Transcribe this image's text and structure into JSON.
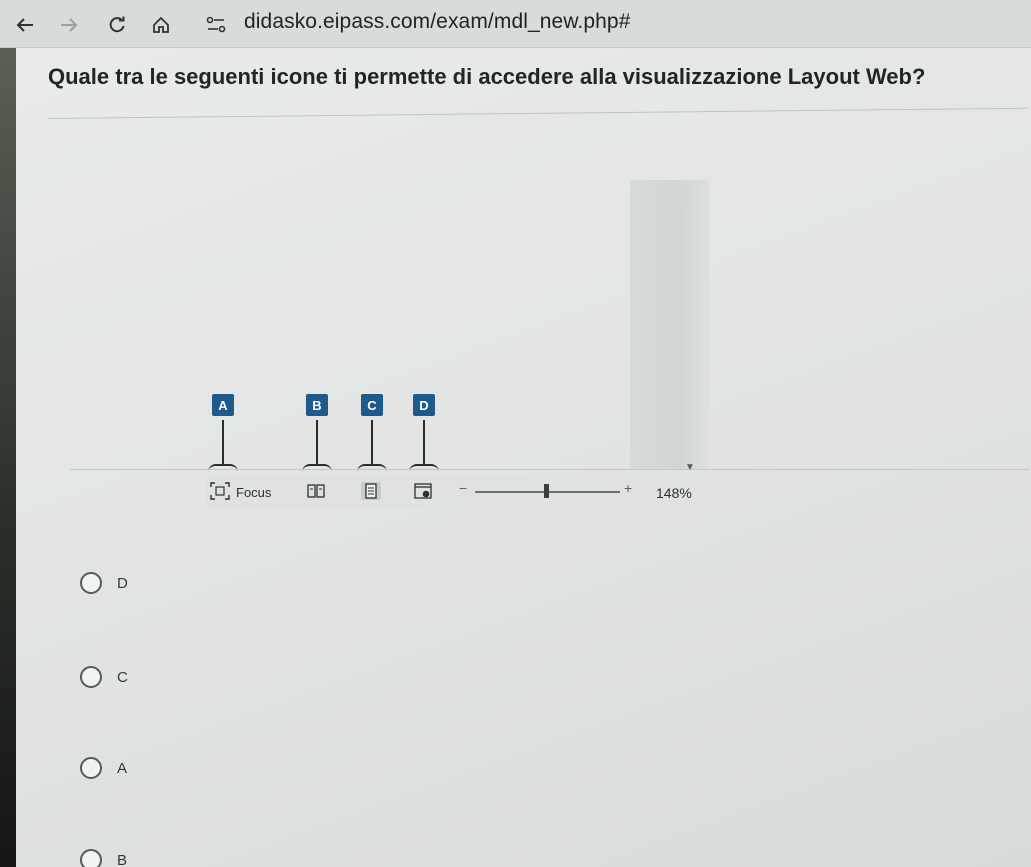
{
  "browser": {
    "url": "didasko.eipass.com/exam/mdl_new.php#",
    "icons": [
      "back-arrow-icon",
      "forward-arrow-icon",
      "reload-icon",
      "home-icon",
      "site-info-icon"
    ]
  },
  "question": {
    "text": "Quale tra le seguenti icone ti permette di accedere alla visualizzazione Layout Web?"
  },
  "figure": {
    "callouts": [
      {
        "letter": "A"
      },
      {
        "letter": "B"
      },
      {
        "letter": "C"
      },
      {
        "letter": "D"
      }
    ],
    "statusbar": {
      "focus_label": "Focus",
      "zoom_minus": "−",
      "zoom_plus": "+",
      "zoom_value": "148%"
    },
    "callout_color": "#1f5a8c"
  },
  "answers": {
    "options": [
      {
        "label": "D"
      },
      {
        "label": "C"
      },
      {
        "label": "A"
      },
      {
        "label": "B"
      }
    ]
  }
}
